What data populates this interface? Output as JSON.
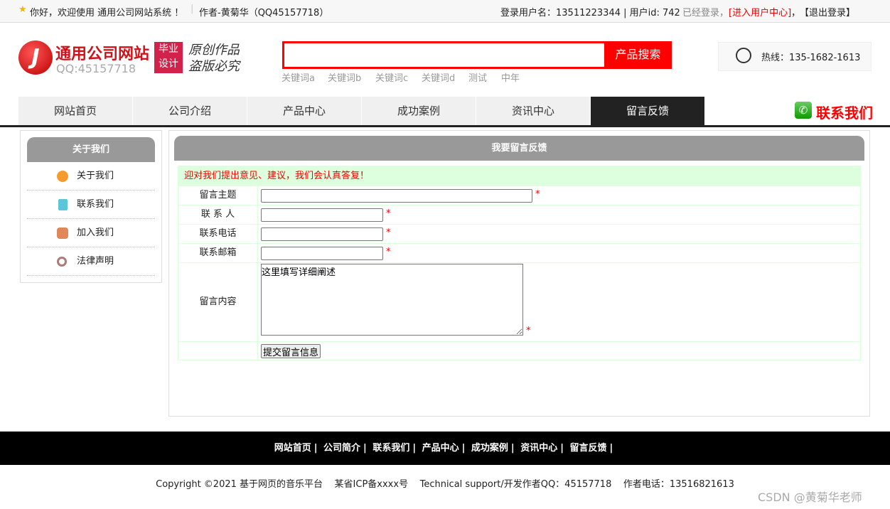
{
  "topbar": {
    "welcome": "你好，欢迎使用 通用公司网站系统 ！",
    "author": "作者-黄菊华（QQ45157718）",
    "login_info": "登录用户名：13511223344 | 用户id: 742",
    "logged": "已经登录，",
    "user_center": "[进入用户中心]",
    "comma": "，",
    "logout": "【退出登录】"
  },
  "header": {
    "site_name": "通用公司网站",
    "qq": "QQ:45157718",
    "badge1": "毕业",
    "badge2": "设计",
    "slogan1": "原创作品",
    "slogan2": "盗版必究",
    "search_placeholder": "",
    "search_button": "产品搜索",
    "keywords": [
      "关键词a",
      "关键词b",
      "关键词c",
      "关键词d",
      "测试",
      "中年"
    ],
    "hotline": "热线：135-1682-1613",
    "contact": "联系我们"
  },
  "nav": [
    "网站首页",
    "公司介绍",
    "产品中心",
    "成功案例",
    "资讯中心",
    "留言反馈"
  ],
  "sidebar": {
    "title": "关于我们",
    "items": [
      {
        "label": "关于我们",
        "color": "#f89b2d"
      },
      {
        "label": "联系我们",
        "color": "#5bc5d9"
      },
      {
        "label": "加入我们",
        "color": "#e0885a"
      },
      {
        "label": "法律声明",
        "color": "#b07a78"
      }
    ]
  },
  "main": {
    "title": "我要留言反馈",
    "notice": "迎对我们提出意见、建议，我们会认真答复！",
    "fields": [
      "留言主题",
      "联 系 人",
      "联系电话",
      "联系邮箱"
    ],
    "content_label": "留言内容",
    "content_value": "这里填写详细阐述",
    "required": "*",
    "submit": "提交留言信息"
  },
  "footer": {
    "links": [
      "网站首页",
      "公司简介",
      "联系我们",
      "产品中心",
      "成功案例",
      "资讯中心",
      "留言反馈"
    ],
    "sep": "|",
    "copyright": "Copyright ©2021 基于网页的音乐平台    某省ICP备xxxx号    Technical support/开发作者QQ：45157718    作者电话：13516821613"
  },
  "watermark": "CSDN @黄菊华老师"
}
